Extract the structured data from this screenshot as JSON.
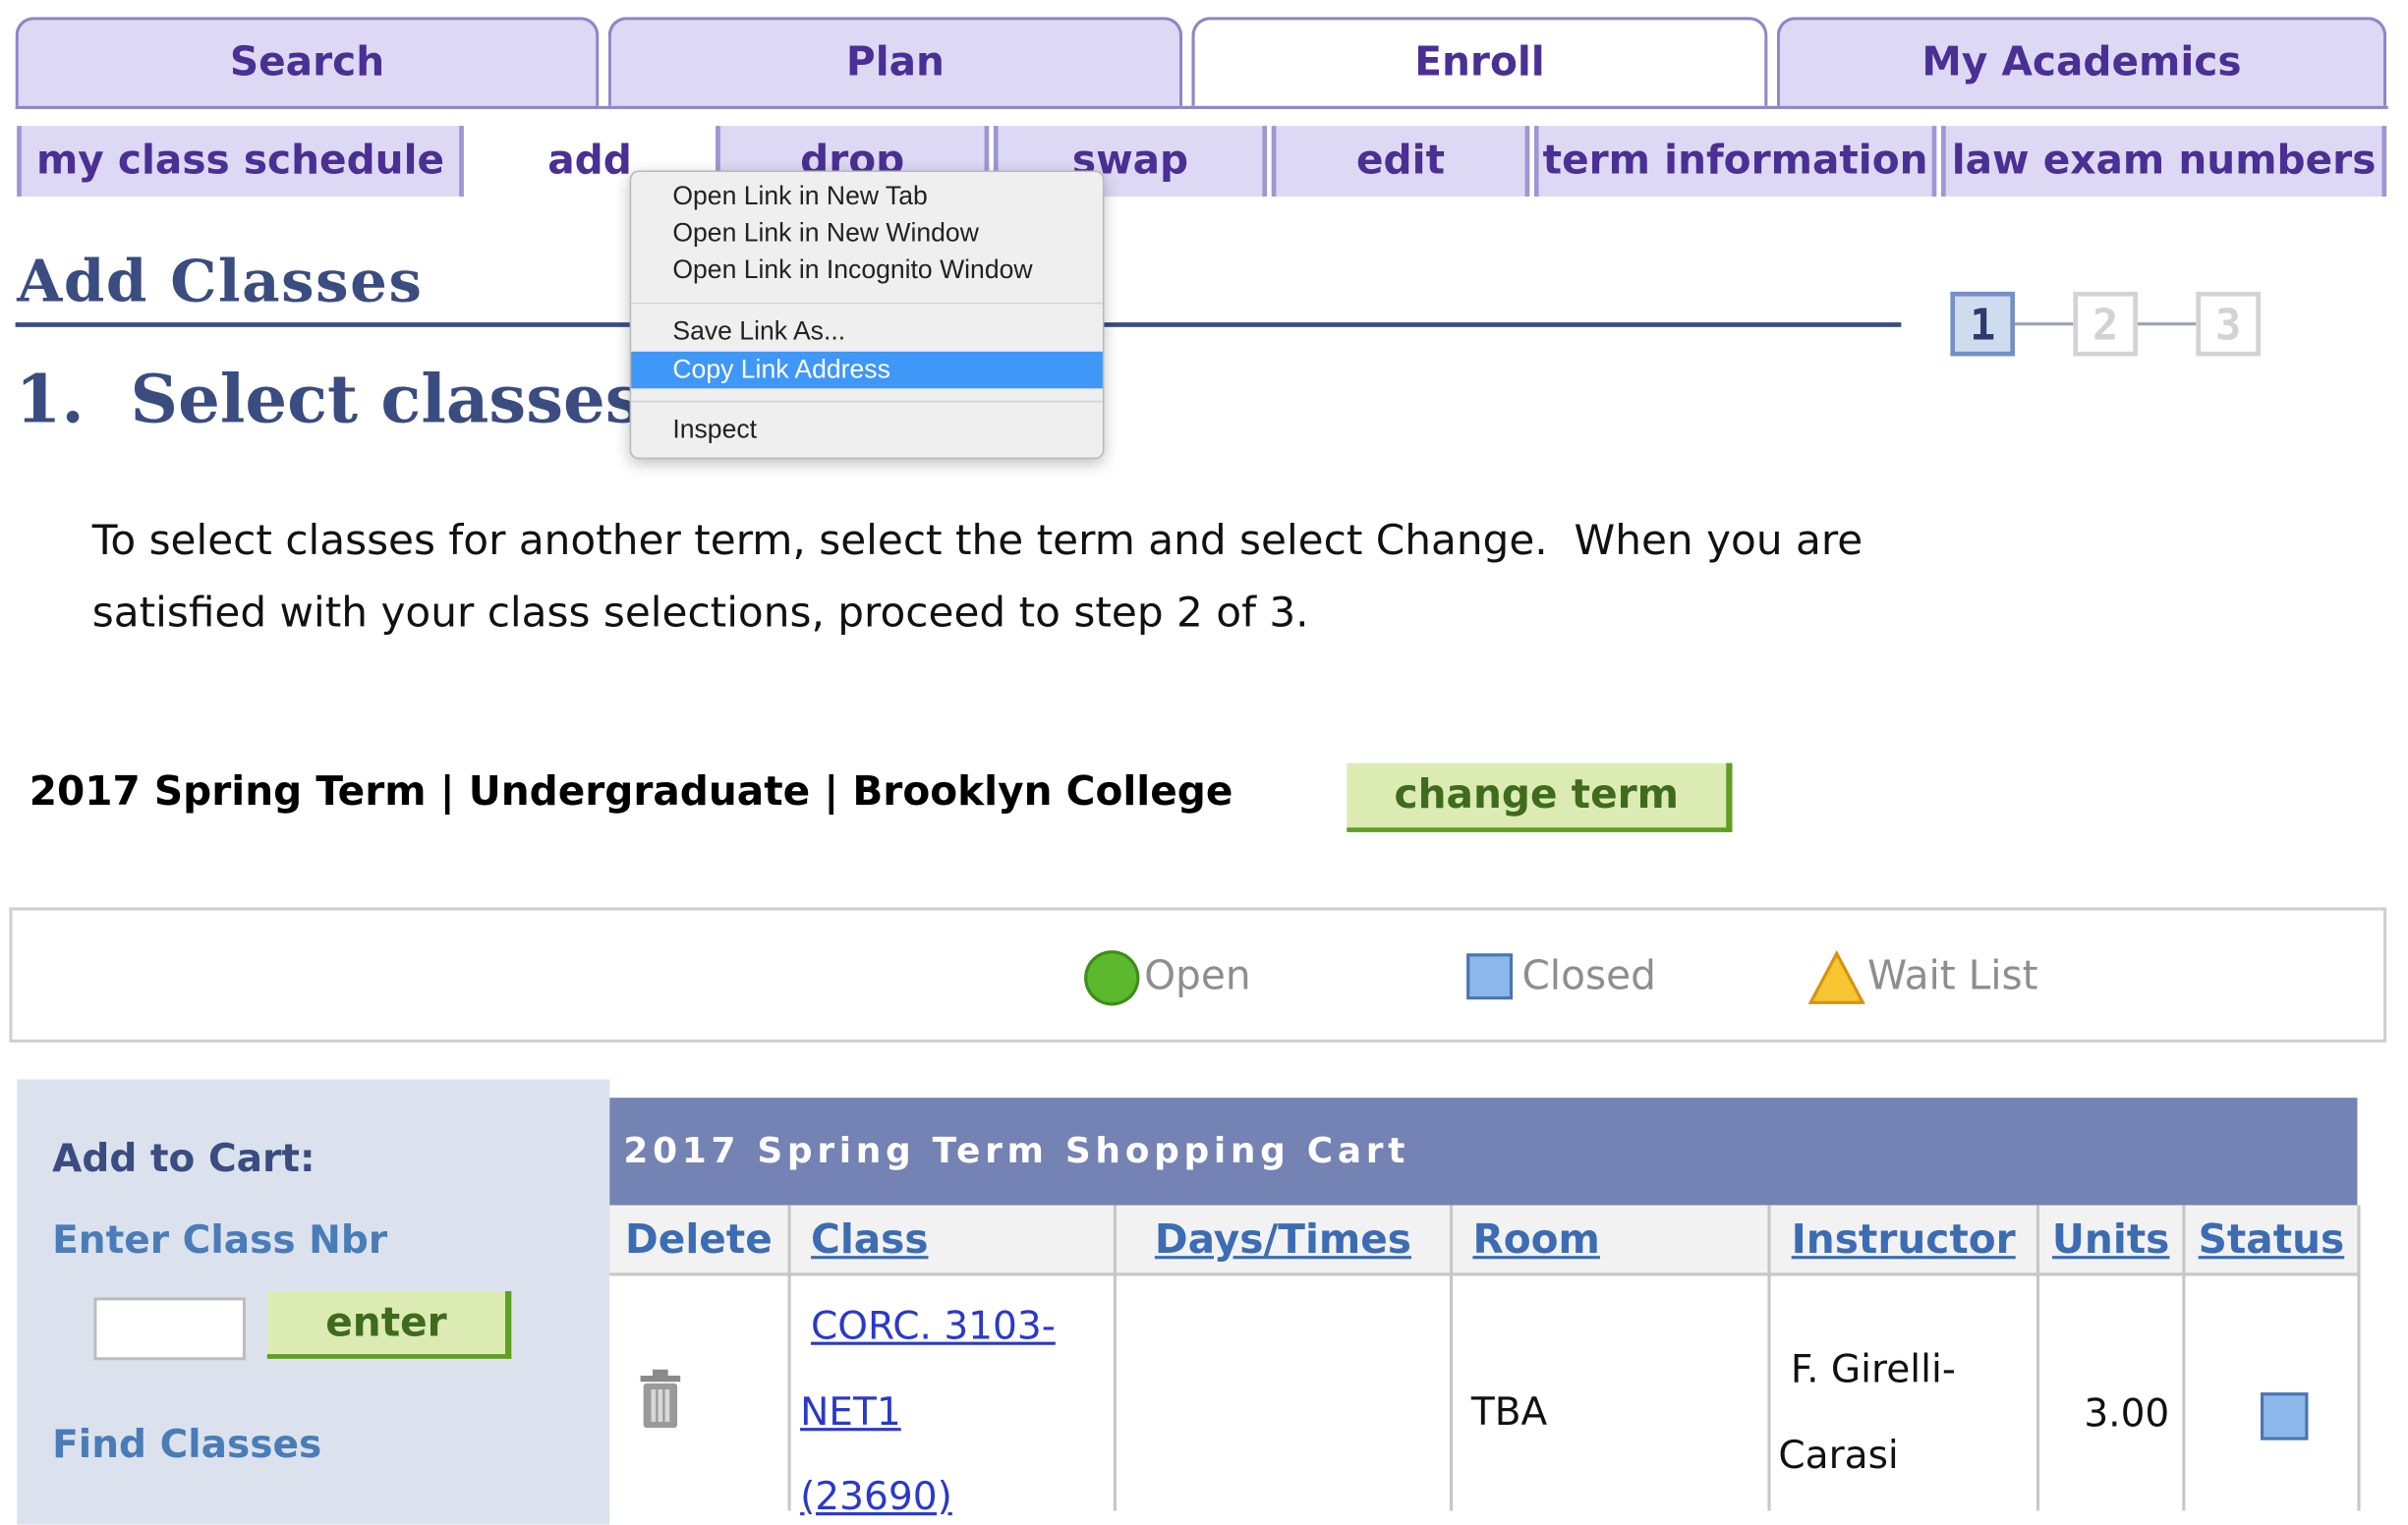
{
  "nav": {
    "tabs": [
      {
        "label": "Search",
        "active": false
      },
      {
        "label": "Plan",
        "active": false
      },
      {
        "label": "Enroll",
        "active": true
      },
      {
        "label": "My Academics",
        "active": false
      }
    ],
    "subtabs": [
      {
        "label": "my class schedule"
      },
      {
        "label": "add",
        "active": true
      },
      {
        "label": "drop"
      },
      {
        "label": "swap"
      },
      {
        "label": "edit"
      },
      {
        "label": "term information"
      },
      {
        "label": "law exam numbers"
      }
    ]
  },
  "context_menu": {
    "items": [
      "Open Link in New Tab",
      "Open Link in New Window",
      "Open Link in Incognito Window",
      "Save Link As...",
      "Copy Link Address",
      "Inspect"
    ],
    "highlighted": "Copy Link Address"
  },
  "page": {
    "title": "Add Classes",
    "step_heading": "1.  Select classes to",
    "steps": [
      "1",
      "2",
      "3"
    ],
    "current_step": 1,
    "instructions_line1": "To select classes for another term, select the term and select Change.  When you are",
    "instructions_line2": "satisfied with your class selections, proceed to step 2 of 3.",
    "term_info": "2017 Spring Term | Undergraduate | Brooklyn College",
    "change_term_label": "change term"
  },
  "legend": {
    "open": "Open",
    "closed": "Closed",
    "wait_list": "Wait List"
  },
  "left_panel": {
    "add_to_cart": "Add to Cart:",
    "enter_class_nbr": "Enter Class Nbr",
    "class_nbr_value": "",
    "enter_button": "enter",
    "find_classes": "Find Classes"
  },
  "cart": {
    "title": "2017 Spring Term Shopping Cart",
    "columns": [
      "Delete",
      "Class",
      "Days/Times",
      "Room",
      "Instructor",
      "Units",
      "Status"
    ],
    "rows": [
      {
        "class_line1": "CORC. 3103-",
        "class_line2": "NET1",
        "class_line3": "(23690)",
        "days_times": "",
        "room": "TBA",
        "instructor_line1": "F. Girelli-",
        "instructor_line2": "Carasi",
        "units": "3.00",
        "status": "Closed"
      }
    ]
  },
  "colors": {
    "tab_bg": "#ddd9f5",
    "tab_text": "#4a2f94",
    "heading": "#3a4c80",
    "cart_header": "#7482b4",
    "button_green": "#dcebb3",
    "menu_highlight": "#3f97f7"
  }
}
